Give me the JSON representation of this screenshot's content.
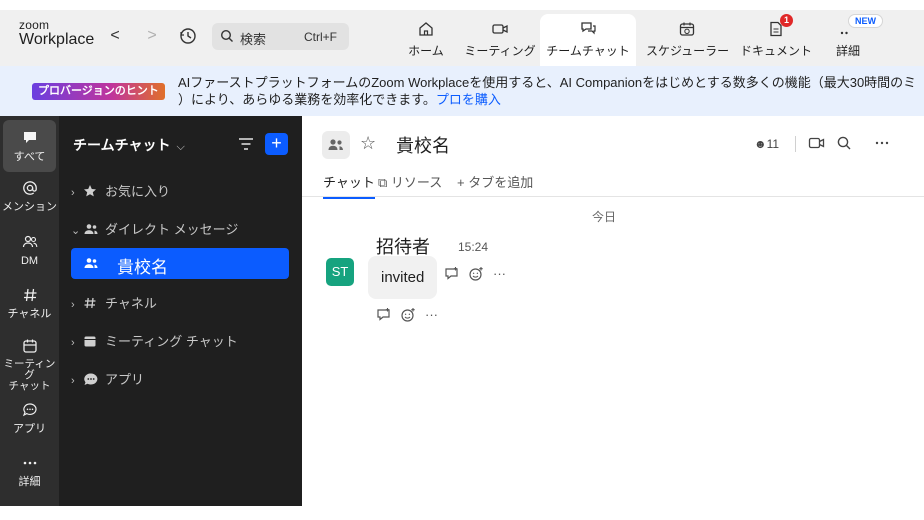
{
  "app": {
    "logo_top": "zoom",
    "logo_bottom": "Workplace"
  },
  "nav": {
    "back": "<",
    "forward": ">"
  },
  "search": {
    "label": "検索",
    "shortcut": "Ctrl+F"
  },
  "tabs": [
    {
      "label": "ホーム",
      "icon": "home-icon"
    },
    {
      "label": "ミーティング",
      "icon": "video-camera-icon"
    },
    {
      "label": "チームチャット",
      "icon": "chat-icon",
      "active": true
    },
    {
      "label": "スケジューラー",
      "icon": "calendar-clock-icon"
    },
    {
      "label": "ドキュメント",
      "icon": "document-icon",
      "badge": "1"
    },
    {
      "label": "詳細",
      "icon": "more-icon",
      "badge": "NEW"
    }
  ],
  "banner": {
    "badge": "プロバージョンのヒント",
    "line1": "AIファーストプラットフォームのZoom Workplaceを使用すると、AI Companionをはじめとする数多くの機能（最大30時間のミ",
    "line2": "）により、あらゆる業務を効率化できます。",
    "link": "プロを購入"
  },
  "rail": [
    {
      "label": "すべて",
      "icon": "chat-bubble-icon",
      "active": true
    },
    {
      "label": "メンション",
      "icon": "at-sign-icon"
    },
    {
      "label": "DM",
      "icon": "people-icon"
    },
    {
      "label": "チャネル",
      "icon": "hash-icon"
    },
    {
      "label": "ミーティング\nチャット",
      "icon": "calendar-icon"
    },
    {
      "label": "アプリ",
      "icon": "app-bubble-icon"
    },
    {
      "label": "詳細",
      "icon": "ellipsis-icon"
    }
  ],
  "chatlist": {
    "title": "チームチャット",
    "sections": [
      {
        "label": "お気に入り",
        "icon": "star-icon",
        "expanded": false
      },
      {
        "label": "ダイレクト メッセージ",
        "icon": "people-icon",
        "expanded": true
      },
      {
        "label": "チャネル",
        "icon": "hash-icon",
        "expanded": false
      },
      {
        "label": "ミーティング チャット",
        "icon": "calendar-icon",
        "expanded": false
      },
      {
        "label": "アプリ",
        "icon": "app-bubble-icon",
        "expanded": false
      }
    ],
    "selected": "貴校名"
  },
  "chat": {
    "title": "貴校名",
    "member_count": "11",
    "subtabs": [
      "チャット",
      "リソース",
      "タブを追加"
    ],
    "date_label": "今日",
    "message": {
      "sender": "招待者",
      "time": "15:24",
      "avatar_initials": "ST",
      "text": "invited",
      "more": "···"
    }
  },
  "colors": {
    "accent": "#0b5cff",
    "rail_bg": "#2e2e2e",
    "list_bg": "#1f1f1f",
    "avatar_green": "#16a37f",
    "badge_red": "#e02828"
  }
}
